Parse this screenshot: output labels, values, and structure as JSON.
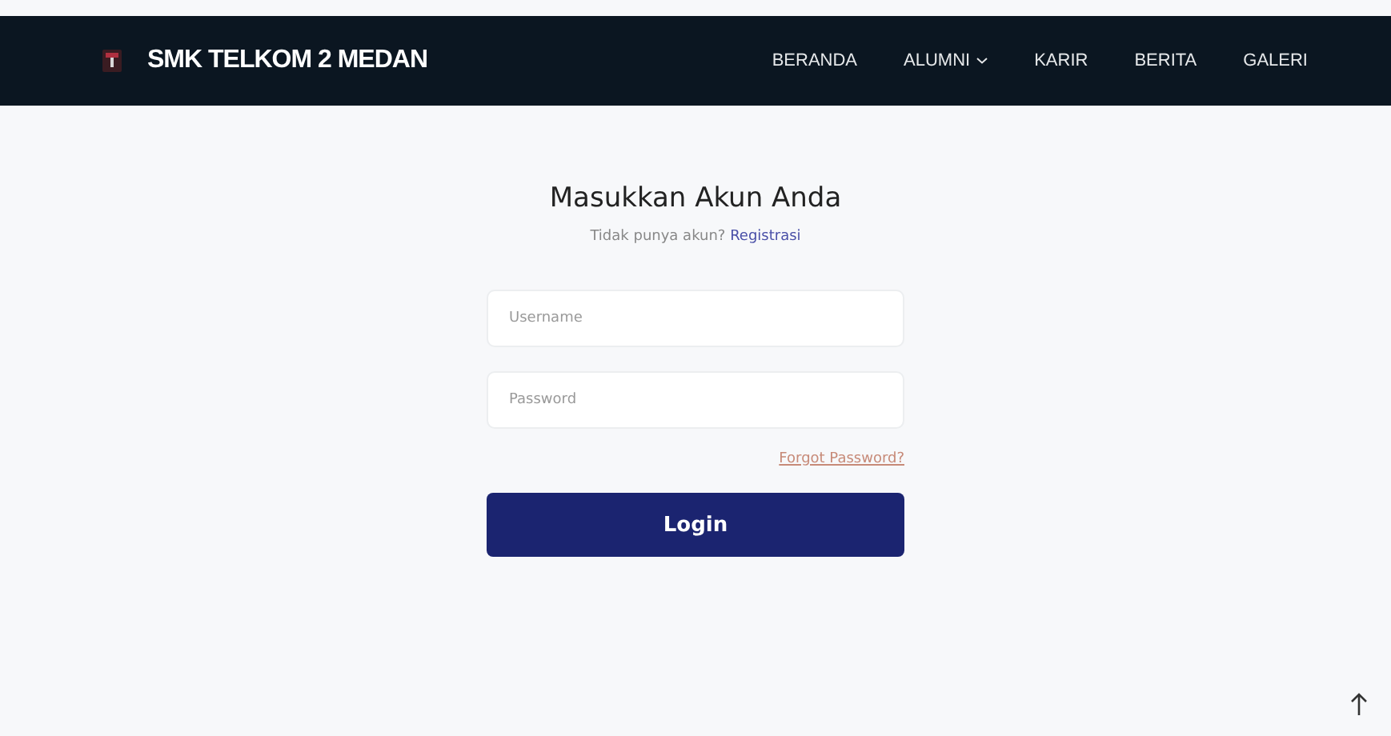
{
  "navbar": {
    "brand": "SMK TELKOM 2 MEDAN",
    "links": [
      {
        "label": "BERANDA",
        "dropdown": false
      },
      {
        "label": "ALUMNI",
        "dropdown": true
      },
      {
        "label": "KARIR",
        "dropdown": false
      },
      {
        "label": "BERITA",
        "dropdown": false
      },
      {
        "label": "GALERI",
        "dropdown": false
      }
    ]
  },
  "login": {
    "title": "Masukkan Akun Anda",
    "prompt": "Tidak punya akun?",
    "register_link": "Registrasi",
    "fields": [
      {
        "placeholder": "Username"
      },
      {
        "placeholder": "Password"
      }
    ],
    "forgot_link": "Forgot Password?",
    "submit": "Login"
  }
}
